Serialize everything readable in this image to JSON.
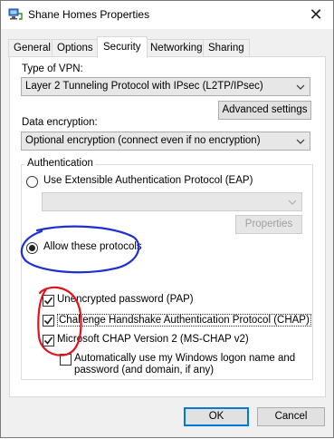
{
  "window": {
    "title": "Shane Homes Properties",
    "close_glyph": "✕"
  },
  "tabs": [
    {
      "label": "General",
      "active": false
    },
    {
      "label": "Options",
      "active": false
    },
    {
      "label": "Security",
      "active": true
    },
    {
      "label": "Networking",
      "active": false
    },
    {
      "label": "Sharing",
      "active": false
    }
  ],
  "security": {
    "vpn_type_label": "Type of VPN:",
    "vpn_type_value": "Layer 2 Tunneling Protocol with IPsec (L2TP/IPsec)",
    "advanced_settings_label": "Advanced settings",
    "encryption_label": "Data encryption:",
    "encryption_value": "Optional encryption (connect even if no encryption)",
    "authentication_title": "Authentication",
    "eap_radio_label": "Use Extensible Authentication Protocol (EAP)",
    "eap_value": "",
    "properties_label": "Properties",
    "allow_protocols_label": "Allow these protocols",
    "protocols": [
      {
        "label": "Unencrypted password (PAP)",
        "checked": true
      },
      {
        "label": "Challenge Handshake Authentication Protocol (CHAP)",
        "checked": true
      },
      {
        "label": "Microsoft CHAP Version 2 (MS-CHAP v2)",
        "checked": true
      }
    ],
    "auto_logon_label_line1": "Automatically use my Windows logon name and",
    "auto_logon_label_line2": "password (and domain, if any)",
    "auto_logon_checked": false
  },
  "footer": {
    "ok_label": "OK",
    "cancel_label": "Cancel"
  },
  "colors": {
    "annotation_blue": "#1f2fd6",
    "annotation_red": "#e0141e",
    "focus_blue": "#0078d7"
  },
  "icons": {
    "title": "network-connection-icon",
    "close": "close-icon",
    "dropdown": "chevron-down-icon"
  }
}
